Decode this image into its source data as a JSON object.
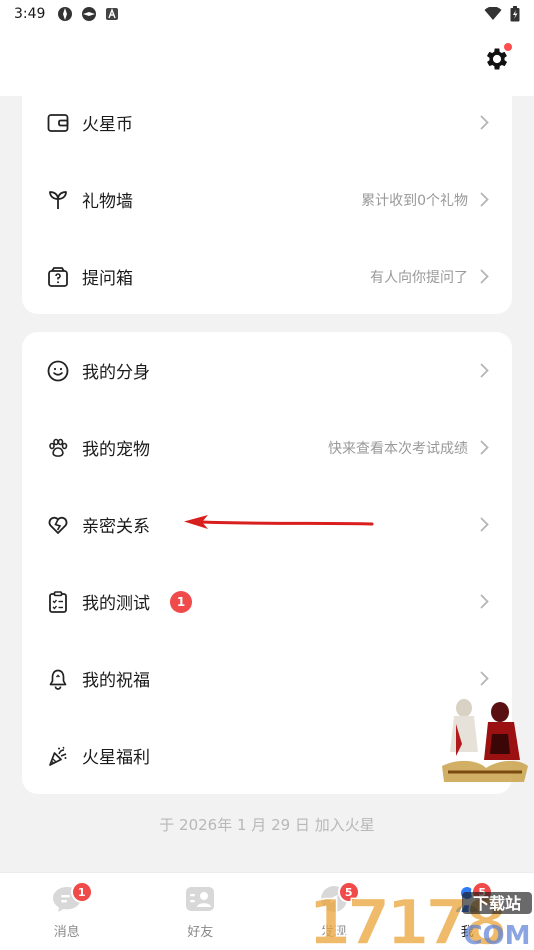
{
  "status_bar": {
    "time": "3:49"
  },
  "header": {
    "settings_icon": "gear-icon"
  },
  "card1": {
    "items": [
      {
        "label": "火星币",
        "hint": "",
        "icon": "wallet-icon"
      },
      {
        "label": "礼物墙",
        "hint": "累计收到0个礼物",
        "icon": "gift-flower-icon"
      },
      {
        "label": "提问箱",
        "hint": "有人向你提问了",
        "icon": "question-box-icon"
      }
    ]
  },
  "card2": {
    "items": [
      {
        "label": "我的分身",
        "hint": "",
        "icon": "smiley-icon"
      },
      {
        "label": "我的宠物",
        "hint": "快来查看本次考试成绩",
        "icon": "paw-icon"
      },
      {
        "label": "亲密关系",
        "hint": "",
        "icon": "heart-link-icon"
      },
      {
        "label": "我的测试",
        "hint": "",
        "badge": "1",
        "icon": "clipboard-check-icon"
      },
      {
        "label": "我的祝福",
        "hint": "",
        "icon": "bell-icon"
      },
      {
        "label": "火星福利",
        "hint": "",
        "icon": "party-popper-icon"
      }
    ]
  },
  "join_text": "于 2026年 1 月 29 日 加入火星",
  "tabs": [
    {
      "label": "消息",
      "badge": "1",
      "icon": "chat-bubble-icon"
    },
    {
      "label": "好友",
      "badge": "",
      "icon": "contact-card-icon"
    },
    {
      "label": "发现",
      "badge": "5",
      "icon": "compass-icon"
    },
    {
      "label": "我",
      "badge": "5",
      "icon": "person-icon"
    }
  ],
  "watermark": {
    "site": "17178",
    "site_sub": "下载站",
    "domain": "COM"
  },
  "colors": {
    "accent_red": "#f04a4a",
    "hint_gray": "#999999",
    "bg": "#f2f2f2"
  }
}
